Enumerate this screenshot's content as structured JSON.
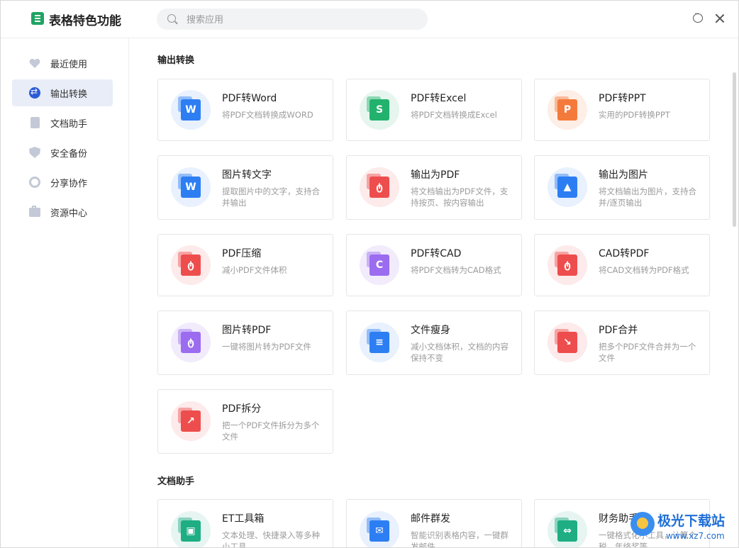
{
  "app": {
    "title": "表格特色功能"
  },
  "search": {
    "placeholder": "搜索应用"
  },
  "sidebar": {
    "items": [
      {
        "label": "最近使用"
      },
      {
        "label": "输出转换"
      },
      {
        "label": "文档助手"
      },
      {
        "label": "安全备份"
      },
      {
        "label": "分享协作"
      },
      {
        "label": "资源中心"
      }
    ]
  },
  "sections": [
    {
      "title": "输出转换",
      "cards": [
        {
          "title": "PDF转Word",
          "desc": "将PDF文档转换成WORD",
          "icon": "pdf-to-word-icon",
          "color": "#2d7ef3"
        },
        {
          "title": "PDF转Excel",
          "desc": "将PDF文档转换成Excel",
          "icon": "pdf-to-excel-icon",
          "color": "#23b26d"
        },
        {
          "title": "PDF转PPT",
          "desc": "实用的PDF转换PPT",
          "icon": "pdf-to-ppt-icon",
          "color": "#f47a3c"
        },
        {
          "title": "图片转文字",
          "desc": "提取图片中的文字，支持合并输出",
          "icon": "image-to-text-icon",
          "color": "#2d7ef3"
        },
        {
          "title": "输出为PDF",
          "desc": "将文档输出为PDF文件，支持按页、按内容输出",
          "icon": "export-pdf-icon",
          "color": "#ee4d4d"
        },
        {
          "title": "输出为图片",
          "desc": "将文档输出为图片，支持合并/逐页输出",
          "icon": "export-image-icon",
          "color": "#2d7ef3"
        },
        {
          "title": "PDF压缩",
          "desc": "减小PDF文件体积",
          "icon": "pdf-compress-icon",
          "color": "#ee4d4d"
        },
        {
          "title": "PDF转CAD",
          "desc": "将PDF文档转为CAD格式",
          "icon": "pdf-to-cad-icon",
          "color": "#9b6cf0"
        },
        {
          "title": "CAD转PDF",
          "desc": "将CAD文档转为PDF格式",
          "icon": "cad-to-pdf-icon",
          "color": "#ee4d4d"
        },
        {
          "title": "图片转PDF",
          "desc": "一键将图片转为PDF文件",
          "icon": "image-to-pdf-icon",
          "color": "#9b6cf0"
        },
        {
          "title": "文件瘦身",
          "desc": "减小文档体积，文档的内容保持不变",
          "icon": "file-slim-icon",
          "color": "#2d7ef3"
        },
        {
          "title": "PDF合并",
          "desc": "把多个PDF文件合并为一个文件",
          "icon": "pdf-merge-icon",
          "color": "#ee4d4d"
        },
        {
          "title": "PDF拆分",
          "desc": "把一个PDF文件拆分为多个文件",
          "icon": "pdf-split-icon",
          "color": "#ee4d4d"
        }
      ]
    },
    {
      "title": "文档助手",
      "cards": [
        {
          "title": "ET工具箱",
          "desc": "文本处理、快捷录入等多种小工具",
          "icon": "toolbox-icon",
          "color": "#1fae84"
        },
        {
          "title": "邮件群发",
          "desc": "智能识别表格内容，一键群发邮件",
          "icon": "mail-icon",
          "color": "#2d7ef3"
        },
        {
          "title": "财务助手",
          "desc": "一键格式化小工具，计算个税、年终奖等",
          "icon": "finance-icon",
          "color": "#1fae84"
        }
      ]
    }
  ],
  "glyphs": {
    "pdf-to-word-icon": "W",
    "pdf-to-excel-icon": "S",
    "pdf-to-ppt-icon": "P",
    "image-to-text-icon": "W",
    "export-pdf-icon": "ტ",
    "export-image-icon": "▲",
    "pdf-compress-icon": "ტ",
    "pdf-to-cad-icon": "C",
    "cad-to-pdf-icon": "ტ",
    "image-to-pdf-icon": "ტ",
    "file-slim-icon": "≡",
    "pdf-merge-icon": "↘",
    "pdf-split-icon": "↗",
    "toolbox-icon": "▣",
    "mail-icon": "✉",
    "finance-icon": "⇔"
  },
  "watermark": {
    "text": "极光下载站",
    "url": "www.xz7.com"
  }
}
